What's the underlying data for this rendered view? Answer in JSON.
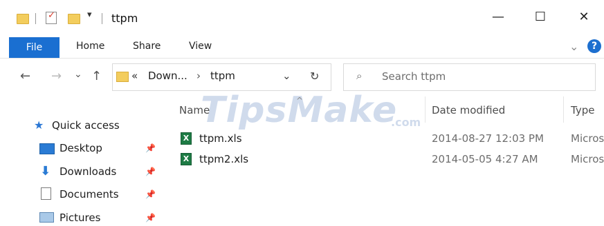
{
  "window": {
    "title": "ttpm",
    "controls": {
      "minimize": "—",
      "maximize": "☐",
      "close": "✕"
    }
  },
  "ribbon": {
    "tabs": [
      "File",
      "Home",
      "Share",
      "View"
    ],
    "expand": "⌄",
    "help": "?"
  },
  "nav": {
    "back": "←",
    "forward": "→",
    "recent": "⌄",
    "up": "↑",
    "breadcrumb": {
      "overflow": "«",
      "segment1": "Down...",
      "chevron": "›",
      "segment2": "ttpm"
    },
    "dropdown": "⌄",
    "refresh": "↻"
  },
  "search": {
    "placeholder": "Search ttpm",
    "icon": "⌕"
  },
  "sidebar": {
    "quick_access": "Quick access",
    "items": [
      {
        "label": "Desktop",
        "pin": "📌"
      },
      {
        "label": "Downloads",
        "pin": "📌"
      },
      {
        "label": "Documents",
        "pin": "📌"
      },
      {
        "label": "Pictures",
        "pin": "📌"
      }
    ]
  },
  "columns": {
    "name": "Name",
    "date": "Date modified",
    "type": "Type",
    "sort_arrow": "^"
  },
  "files": [
    {
      "name": "ttpm.xls",
      "date": "2014-08-27 12:03 PM",
      "type": "Micros"
    },
    {
      "name": "ttpm2.xls",
      "date": "2014-05-05 4:27 AM",
      "type": "Micros"
    }
  ],
  "watermark": {
    "text": "TipsMake",
    "suffix": ".com"
  }
}
